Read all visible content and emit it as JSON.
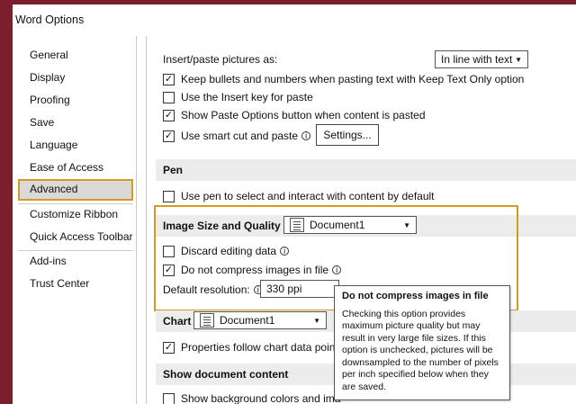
{
  "window": {
    "title": "Word Options"
  },
  "sidebar": {
    "items": [
      {
        "label": "General"
      },
      {
        "label": "Display"
      },
      {
        "label": "Proofing"
      },
      {
        "label": "Save"
      },
      {
        "label": "Language"
      },
      {
        "label": "Ease of Access"
      },
      {
        "label": "Advanced",
        "active": true
      },
      {
        "label": "Customize Ribbon"
      },
      {
        "label": "Quick Access Toolbar"
      },
      {
        "label": "Add-ins"
      },
      {
        "label": "Trust Center"
      }
    ]
  },
  "cut_copy_paste": {
    "insert_paste_label": "Insert/paste pictures as:",
    "insert_paste_value": "In line with text",
    "options": [
      {
        "label": "Keep bullets and numbers when pasting text with Keep Text Only option",
        "checked": true
      },
      {
        "label": "Use the Insert key for paste",
        "checked": false
      },
      {
        "label": "Show Paste Options button when content is pasted",
        "checked": true
      },
      {
        "label": "Use smart cut and paste",
        "checked": true
      }
    ],
    "settings_button": "Settings..."
  },
  "pen": {
    "header": "Pen",
    "option": {
      "label": "Use pen to select and interact with content by default",
      "checked": false
    }
  },
  "image_size": {
    "header": "Image Size and Quality",
    "document": "Document1",
    "options": [
      {
        "label": "Discard editing data",
        "checked": false
      },
      {
        "label": "Do not compress images in file",
        "checked": true
      }
    ],
    "resolution_label": "Default resolution:",
    "resolution_value": "330 ppi"
  },
  "tooltip": {
    "title": "Do not compress images in file",
    "body": "Checking this option provides maximum picture quality but may result in very large file sizes. If this option is unchecked, pictures will be downsampled to the number of pixels per inch specified below when they are saved."
  },
  "chart": {
    "header": "Chart",
    "document": "Document1",
    "option": {
      "label": "Properties follow chart data point",
      "checked": true
    }
  },
  "show_doc": {
    "header": "Show document content",
    "option": {
      "label": "Show background colors and ima",
      "checked": false
    }
  },
  "glyphs": {
    "check": "✓",
    "arrow": "▼",
    "info": "i"
  },
  "colors": {
    "accent": "#d59a1e",
    "frame": "#7a1f2b",
    "selected_bg": "#d9d9d9"
  }
}
